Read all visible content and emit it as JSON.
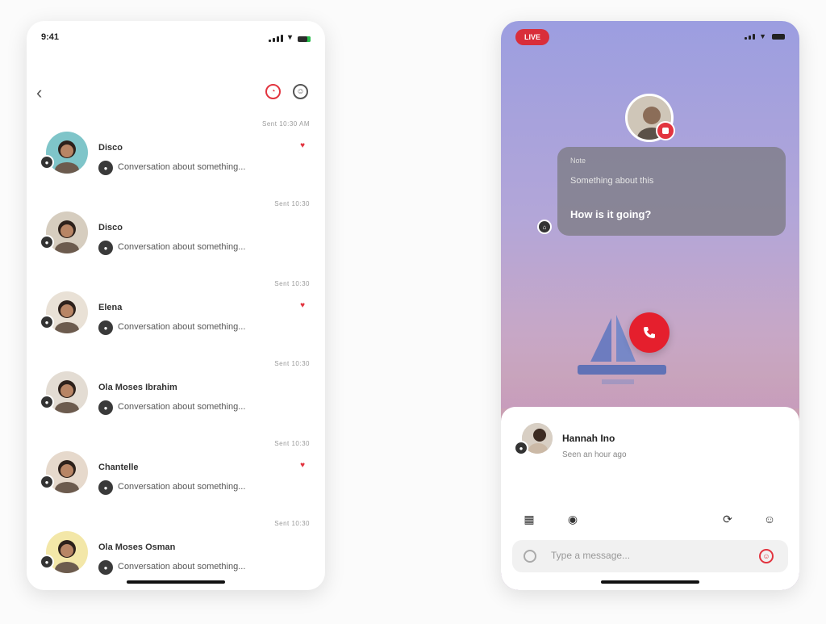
{
  "left_phone": {
    "status": {
      "time": "9:41"
    },
    "chats": [
      {
        "name": "Disco",
        "preview": "Conversation about something...",
        "time": "Sent 10:30 AM",
        "liked": true,
        "avatar_bg": "#7fc5c9"
      },
      {
        "name": "Disco",
        "preview": "Conversation about something...",
        "time": "Sent 10:30",
        "liked": false,
        "avatar_bg": "#d6cdbf"
      },
      {
        "name": "Elena",
        "preview": "Conversation about something...",
        "time": "Sent 10:30",
        "liked": true,
        "avatar_bg": "#e9e1d6"
      },
      {
        "name": "Ola Moses Ibrahim",
        "preview": "Conversation about something...",
        "time": "Sent 10:30",
        "liked": false,
        "avatar_bg": "#e3dcd3"
      },
      {
        "name": "Chantelle",
        "preview": "Conversation about something...",
        "time": "Sent 10:30",
        "liked": true,
        "avatar_bg": "#e6d9cc"
      },
      {
        "name": "Ola Moses Osman",
        "preview": "Conversation about something...",
        "time": "Sent 10:30",
        "liked": false,
        "avatar_bg": "#f3e7a8"
      }
    ]
  },
  "right_phone": {
    "live_badge": "LIVE",
    "bubble": {
      "small": "Note",
      "sub": "Something about this",
      "main": "How is it going?"
    },
    "sheet": {
      "name": "Hannah Ino",
      "status": "Seen an hour ago"
    },
    "input_placeholder": "Type a message..."
  },
  "colors": {
    "accent": "#e2343f"
  }
}
